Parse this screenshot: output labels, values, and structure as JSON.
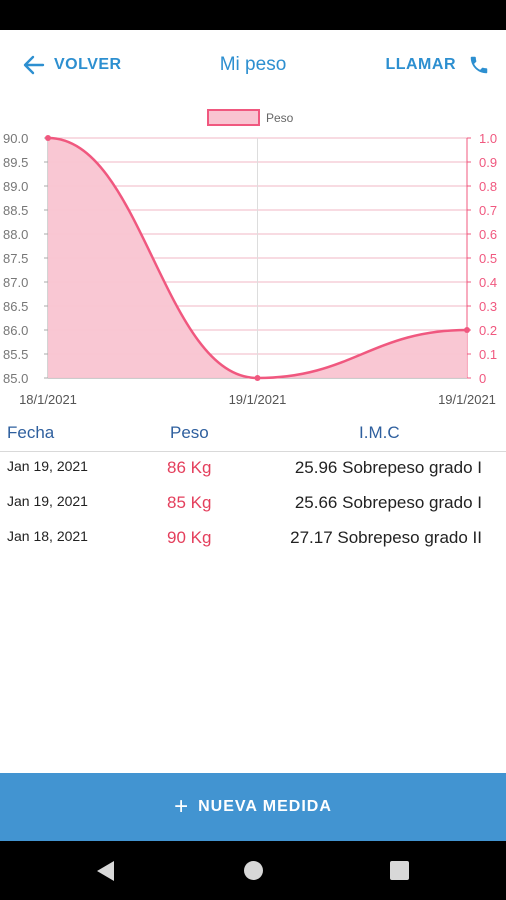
{
  "header": {
    "back_label": "VOLVER",
    "title": "Mi peso",
    "call_label": "LLAMAR",
    "back_icon": "arrow-left-icon",
    "call_icon": "phone-icon"
  },
  "chart_data": {
    "type": "area",
    "title": "",
    "xlabel": "",
    "ylabel": "",
    "categories": [
      "18/1/2021",
      "19/1/2021",
      "19/1/2021"
    ],
    "series": [
      {
        "name": "Peso",
        "values": [
          90.0,
          85.0,
          86.0
        ]
      }
    ],
    "ylim": [
      85.0,
      90.0
    ],
    "y_ticks": [
      "90.0",
      "89.5",
      "89.0",
      "88.5",
      "88.0",
      "87.5",
      "87.0",
      "86.5",
      "86.0",
      "85.5",
      "85.0"
    ],
    "right_ylim": [
      0,
      1.0
    ],
    "right_ticks": [
      "1.0",
      "0.9",
      "0.8",
      "0.7",
      "0.6",
      "0.5",
      "0.4",
      "0.3",
      "0.2",
      "0.1",
      "0"
    ],
    "grid": true,
    "legend": "top-center",
    "colors": {
      "line": "#f0587f",
      "fill": "#f9c4d1",
      "grid": "#f2b7c4",
      "left_axis": "#777777",
      "right_axis": "#f0587f"
    }
  },
  "table": {
    "headers": {
      "fecha": "Fecha",
      "peso": "Peso",
      "imc": "I.M.C"
    },
    "rows": [
      {
        "date": "Jan 19, 2021",
        "weight": "86 Kg",
        "imc": "25.96 Sobrepeso grado I"
      },
      {
        "date": "Jan 19, 2021",
        "weight": "85 Kg",
        "imc": "25.66 Sobrepeso grado I"
      },
      {
        "date": "Jan 18, 2021",
        "weight": "90 Kg",
        "imc": "27.17 Sobrepeso grado II"
      }
    ]
  },
  "footer": {
    "button_label": "NUEVA MEDIDA",
    "button_icon": "plus-icon"
  },
  "colors": {
    "accent": "#2d8fd0",
    "button_bg": "#4294d1",
    "weight_text": "#e43f5c",
    "header_text": "#2e5f9e"
  }
}
